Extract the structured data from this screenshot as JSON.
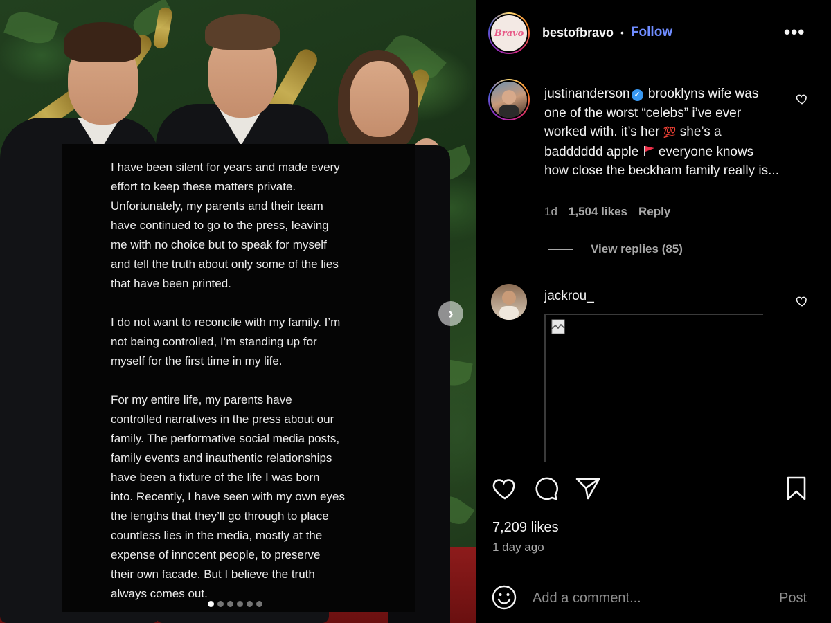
{
  "post": {
    "statement_paragraphs": [
      "I have been silent for years and made every\neffort to keep these matters private.\nUnfortunately, my parents and their team\nhave continued to go to the press, leaving\nme with no choice but to speak for myself\nand tell the truth about only some of the lies\nthat have been printed.",
      "I do not want to reconcile with my family. I’m\nnot being controlled, I’m standing up for\nmyself for the first time in my life.",
      "For my entire life, my parents have\ncontrolled narratives in the press about our\nfamily. The performative social media posts,\nfamily events and inauthentic relationships\nhave been a fixture of the life I was born\ninto. Recently, I have seen with my own eyes\nthe lengths that they’ll go through to place\ncountless lies in the media, mostly at the\nexpense of innocent people, to preserve\ntheir own facade. But I believe the truth\nalways comes out."
    ],
    "carousel": {
      "total_slides": 6,
      "active_index": 0
    }
  },
  "header": {
    "avatar_text": "Bravo",
    "username": "bestofbravo",
    "separator": "•",
    "follow_label": "Follow",
    "more_label": "•••"
  },
  "comments": [
    {
      "username": "justinanderson",
      "verified": true,
      "text_1": "brooklyns wife was one of the worst “celebs” i’ve ever worked with. it’s her",
      "emoji_1": "💯",
      "text_2": "she’s a badddddd apple",
      "text_3": "everyone knows how close the beckham family really is...",
      "time": "1d",
      "likes": "1,504 likes",
      "reply_label": "Reply",
      "view_replies": "View replies (85)"
    },
    {
      "username": "jackrou_"
    }
  ],
  "actions": {
    "like_icon": "heart-icon",
    "comment_icon": "comment-icon",
    "share_icon": "send-icon",
    "save_icon": "bookmark-icon"
  },
  "stats": {
    "likes": "7,209 likes",
    "time_ago": "1 day ago"
  },
  "add_comment": {
    "placeholder": "Add a comment...",
    "post_label": "Post"
  },
  "colors": {
    "background": "#000000",
    "follow": "#6f8cff",
    "muted": "#a8a8a8",
    "verified": "#3897f0"
  }
}
